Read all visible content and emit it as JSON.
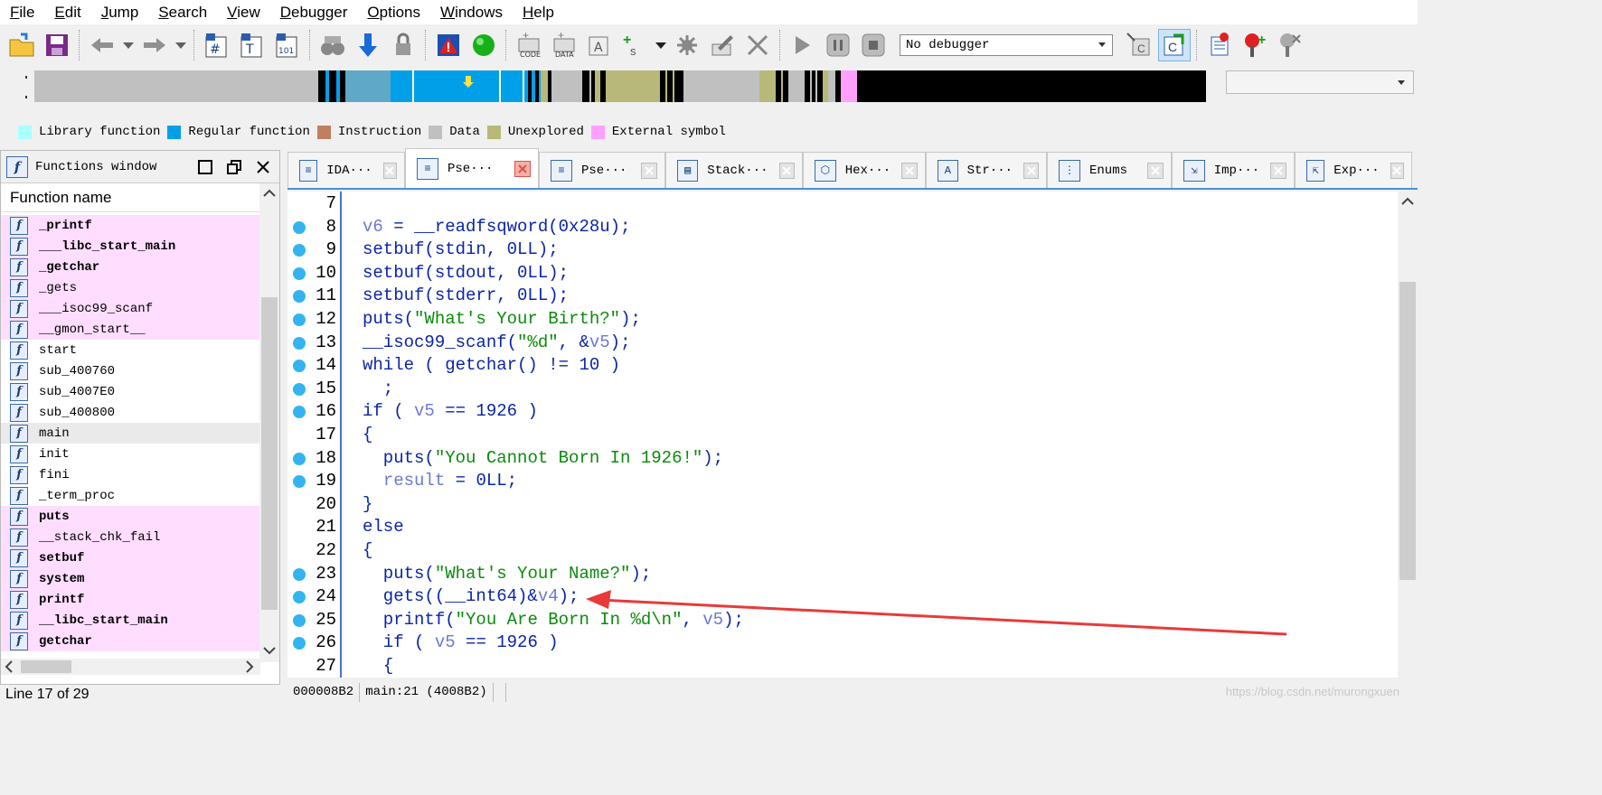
{
  "menu": [
    "File",
    "Edit",
    "Jump",
    "Search",
    "View",
    "Debugger",
    "Options",
    "Windows",
    "Help"
  ],
  "menu_underline": [
    "F",
    "E",
    "J",
    "S",
    "V",
    "D",
    "O",
    "W",
    "H"
  ],
  "toolbar": {
    "debugger_select": "No debugger"
  },
  "legend": [
    {
      "label": "Library function",
      "color": "#aaffff"
    },
    {
      "label": "Regular function",
      "color": "#00a0e8"
    },
    {
      "label": "Instruction",
      "color": "#c08060"
    },
    {
      "label": "Data",
      "color": "#c0c0c0"
    },
    {
      "label": "Unexplored",
      "color": "#b8b878"
    },
    {
      "label": "External symbol",
      "color": "#ffa0ff"
    }
  ],
  "functions_window": {
    "title": "Functions window",
    "column_header": "Function name",
    "items": [
      {
        "name": "_printf",
        "type": "lib",
        "bold": true
      },
      {
        "name": "___libc_start_main",
        "type": "lib",
        "bold": true
      },
      {
        "name": "_getchar",
        "type": "lib",
        "bold": true
      },
      {
        "name": "_gets",
        "type": "lib",
        "bold": false
      },
      {
        "name": "___isoc99_scanf",
        "type": "lib",
        "bold": false
      },
      {
        "name": "__gmon_start__",
        "type": "lib",
        "bold": false
      },
      {
        "name": "start",
        "type": "regular",
        "bold": false
      },
      {
        "name": "sub_400760",
        "type": "regular",
        "bold": false
      },
      {
        "name": "sub_4007E0",
        "type": "regular",
        "bold": false
      },
      {
        "name": "sub_400800",
        "type": "regular",
        "bold": false
      },
      {
        "name": "main",
        "type": "selected",
        "bold": false
      },
      {
        "name": "init",
        "type": "regular",
        "bold": false
      },
      {
        "name": "fini",
        "type": "regular",
        "bold": false
      },
      {
        "name": "_term_proc",
        "type": "regular",
        "bold": false
      },
      {
        "name": "puts",
        "type": "lib",
        "bold": true
      },
      {
        "name": "__stack_chk_fail",
        "type": "lib",
        "bold": false
      },
      {
        "name": "setbuf",
        "type": "lib",
        "bold": true
      },
      {
        "name": "system",
        "type": "lib",
        "bold": true
      },
      {
        "name": "printf",
        "type": "lib",
        "bold": true
      },
      {
        "name": "__libc_start_main",
        "type": "lib",
        "bold": true
      },
      {
        "name": "getchar",
        "type": "lib",
        "bold": true
      }
    ],
    "status": "Line 17 of 29"
  },
  "tabs": [
    {
      "label": "IDA···",
      "icon": "ida-view-icon",
      "active": false
    },
    {
      "label": "Pse···",
      "icon": "pseudocode-icon",
      "active": true
    },
    {
      "label": "Pse···",
      "icon": "pseudocode-icon",
      "active": false
    },
    {
      "label": "Stack···",
      "icon": "stack-icon",
      "active": false
    },
    {
      "label": "Hex···",
      "icon": "hex-view-icon",
      "active": false
    },
    {
      "label": "Str···",
      "icon": "structures-icon",
      "active": false
    },
    {
      "label": "Enums",
      "icon": "enums-icon",
      "active": false
    },
    {
      "label": "Imp···",
      "icon": "imports-icon",
      "active": false
    },
    {
      "label": "Exp···",
      "icon": "exports-icon",
      "active": false
    }
  ],
  "code": [
    {
      "n": "7",
      "bp": false,
      "tokens": []
    },
    {
      "n": "8",
      "bp": true,
      "tokens": [
        [
          "var",
          "v6"
        ],
        [
          "plain",
          " = __readfsqword(0x28u);"
        ]
      ]
    },
    {
      "n": "9",
      "bp": true,
      "tokens": [
        [
          "plain",
          "setbuf(stdin, 0LL);"
        ]
      ]
    },
    {
      "n": "10",
      "bp": true,
      "tokens": [
        [
          "plain",
          "setbuf(stdout, 0LL);"
        ]
      ]
    },
    {
      "n": "11",
      "bp": true,
      "tokens": [
        [
          "plain",
          "setbuf(stderr, 0LL);"
        ]
      ]
    },
    {
      "n": "12",
      "bp": true,
      "tokens": [
        [
          "plain",
          "puts("
        ],
        [
          "str",
          "\"What's Your Birth?\""
        ],
        [
          "plain",
          ");"
        ]
      ]
    },
    {
      "n": "13",
      "bp": true,
      "tokens": [
        [
          "plain",
          "__isoc99_scanf("
        ],
        [
          "str",
          "\"%d\""
        ],
        [
          "plain",
          ", &"
        ],
        [
          "var",
          "v5"
        ],
        [
          "plain",
          ");"
        ]
      ]
    },
    {
      "n": "14",
      "bp": true,
      "tokens": [
        [
          "plain",
          "while ( getchar() != 10 )"
        ]
      ]
    },
    {
      "n": "15",
      "bp": true,
      "tokens": [
        [
          "plain",
          "  ;"
        ]
      ]
    },
    {
      "n": "16",
      "bp": true,
      "tokens": [
        [
          "plain",
          "if ( "
        ],
        [
          "var",
          "v5"
        ],
        [
          "plain",
          " == 1926 )"
        ]
      ]
    },
    {
      "n": "17",
      "bp": false,
      "tokens": [
        [
          "plain",
          "{"
        ]
      ]
    },
    {
      "n": "18",
      "bp": true,
      "tokens": [
        [
          "plain",
          "  puts("
        ],
        [
          "str",
          "\"You Cannot Born In 1926!\""
        ],
        [
          "plain",
          ");"
        ]
      ]
    },
    {
      "n": "19",
      "bp": true,
      "tokens": [
        [
          "plain",
          "  "
        ],
        [
          "var",
          "result"
        ],
        [
          "plain",
          " = 0LL;"
        ]
      ]
    },
    {
      "n": "20",
      "bp": false,
      "tokens": [
        [
          "plain",
          "}"
        ]
      ]
    },
    {
      "n": "21",
      "bp": false,
      "tokens": [
        [
          "plain",
          "else"
        ]
      ]
    },
    {
      "n": "22",
      "bp": false,
      "tokens": [
        [
          "plain",
          "{"
        ]
      ]
    },
    {
      "n": "23",
      "bp": true,
      "tokens": [
        [
          "plain",
          "  puts("
        ],
        [
          "str",
          "\"What's Your Name?\""
        ],
        [
          "plain",
          ");"
        ]
      ]
    },
    {
      "n": "24",
      "bp": true,
      "tokens": [
        [
          "plain",
          "  gets((__int64)&"
        ],
        [
          "var",
          "v4"
        ],
        [
          "plain",
          ");"
        ]
      ]
    },
    {
      "n": "25",
      "bp": true,
      "tokens": [
        [
          "plain",
          "  printf("
        ],
        [
          "str",
          "\"You Are Born In %d\\n\""
        ],
        [
          "plain",
          ", "
        ],
        [
          "var",
          "v5"
        ],
        [
          "plain",
          ");"
        ]
      ]
    },
    {
      "n": "26",
      "bp": true,
      "tokens": [
        [
          "plain",
          "  if ( "
        ],
        [
          "var",
          "v5"
        ],
        [
          "plain",
          " == 1926 )"
        ]
      ]
    },
    {
      "n": "27",
      "bp": false,
      "tokens": [
        [
          "plain",
          "  {"
        ]
      ]
    }
  ],
  "code_status": [
    "000008B2",
    "main:21 (4008B2)"
  ],
  "watermark": "https://blog.csdn.net/murongxuen"
}
